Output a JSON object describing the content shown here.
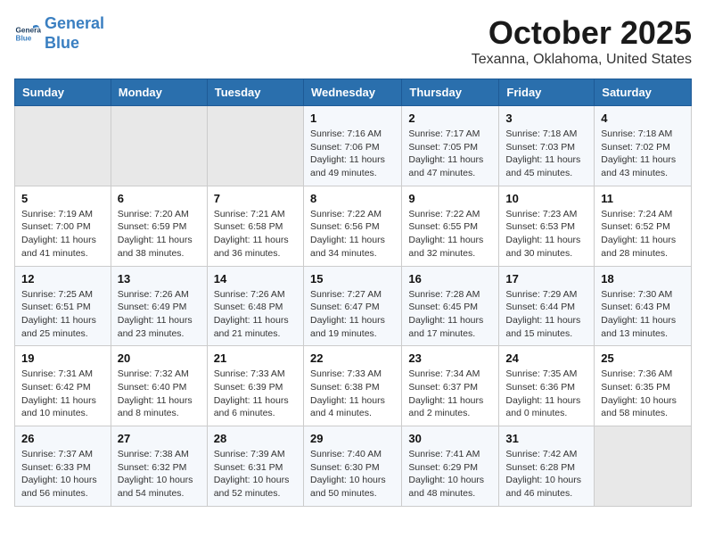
{
  "header": {
    "logo_line1": "General",
    "logo_line2": "Blue",
    "month": "October 2025",
    "location": "Texanna, Oklahoma, United States"
  },
  "weekdays": [
    "Sunday",
    "Monday",
    "Tuesday",
    "Wednesday",
    "Thursday",
    "Friday",
    "Saturday"
  ],
  "weeks": [
    [
      {
        "day": "",
        "info": ""
      },
      {
        "day": "",
        "info": ""
      },
      {
        "day": "",
        "info": ""
      },
      {
        "day": "1",
        "info": "Sunrise: 7:16 AM\nSunset: 7:06 PM\nDaylight: 11 hours and 49 minutes."
      },
      {
        "day": "2",
        "info": "Sunrise: 7:17 AM\nSunset: 7:05 PM\nDaylight: 11 hours and 47 minutes."
      },
      {
        "day": "3",
        "info": "Sunrise: 7:18 AM\nSunset: 7:03 PM\nDaylight: 11 hours and 45 minutes."
      },
      {
        "day": "4",
        "info": "Sunrise: 7:18 AM\nSunset: 7:02 PM\nDaylight: 11 hours and 43 minutes."
      }
    ],
    [
      {
        "day": "5",
        "info": "Sunrise: 7:19 AM\nSunset: 7:00 PM\nDaylight: 11 hours and 41 minutes."
      },
      {
        "day": "6",
        "info": "Sunrise: 7:20 AM\nSunset: 6:59 PM\nDaylight: 11 hours and 38 minutes."
      },
      {
        "day": "7",
        "info": "Sunrise: 7:21 AM\nSunset: 6:58 PM\nDaylight: 11 hours and 36 minutes."
      },
      {
        "day": "8",
        "info": "Sunrise: 7:22 AM\nSunset: 6:56 PM\nDaylight: 11 hours and 34 minutes."
      },
      {
        "day": "9",
        "info": "Sunrise: 7:22 AM\nSunset: 6:55 PM\nDaylight: 11 hours and 32 minutes."
      },
      {
        "day": "10",
        "info": "Sunrise: 7:23 AM\nSunset: 6:53 PM\nDaylight: 11 hours and 30 minutes."
      },
      {
        "day": "11",
        "info": "Sunrise: 7:24 AM\nSunset: 6:52 PM\nDaylight: 11 hours and 28 minutes."
      }
    ],
    [
      {
        "day": "12",
        "info": "Sunrise: 7:25 AM\nSunset: 6:51 PM\nDaylight: 11 hours and 25 minutes."
      },
      {
        "day": "13",
        "info": "Sunrise: 7:26 AM\nSunset: 6:49 PM\nDaylight: 11 hours and 23 minutes."
      },
      {
        "day": "14",
        "info": "Sunrise: 7:26 AM\nSunset: 6:48 PM\nDaylight: 11 hours and 21 minutes."
      },
      {
        "day": "15",
        "info": "Sunrise: 7:27 AM\nSunset: 6:47 PM\nDaylight: 11 hours and 19 minutes."
      },
      {
        "day": "16",
        "info": "Sunrise: 7:28 AM\nSunset: 6:45 PM\nDaylight: 11 hours and 17 minutes."
      },
      {
        "day": "17",
        "info": "Sunrise: 7:29 AM\nSunset: 6:44 PM\nDaylight: 11 hours and 15 minutes."
      },
      {
        "day": "18",
        "info": "Sunrise: 7:30 AM\nSunset: 6:43 PM\nDaylight: 11 hours and 13 minutes."
      }
    ],
    [
      {
        "day": "19",
        "info": "Sunrise: 7:31 AM\nSunset: 6:42 PM\nDaylight: 11 hours and 10 minutes."
      },
      {
        "day": "20",
        "info": "Sunrise: 7:32 AM\nSunset: 6:40 PM\nDaylight: 11 hours and 8 minutes."
      },
      {
        "day": "21",
        "info": "Sunrise: 7:33 AM\nSunset: 6:39 PM\nDaylight: 11 hours and 6 minutes."
      },
      {
        "day": "22",
        "info": "Sunrise: 7:33 AM\nSunset: 6:38 PM\nDaylight: 11 hours and 4 minutes."
      },
      {
        "day": "23",
        "info": "Sunrise: 7:34 AM\nSunset: 6:37 PM\nDaylight: 11 hours and 2 minutes."
      },
      {
        "day": "24",
        "info": "Sunrise: 7:35 AM\nSunset: 6:36 PM\nDaylight: 11 hours and 0 minutes."
      },
      {
        "day": "25",
        "info": "Sunrise: 7:36 AM\nSunset: 6:35 PM\nDaylight: 10 hours and 58 minutes."
      }
    ],
    [
      {
        "day": "26",
        "info": "Sunrise: 7:37 AM\nSunset: 6:33 PM\nDaylight: 10 hours and 56 minutes."
      },
      {
        "day": "27",
        "info": "Sunrise: 7:38 AM\nSunset: 6:32 PM\nDaylight: 10 hours and 54 minutes."
      },
      {
        "day": "28",
        "info": "Sunrise: 7:39 AM\nSunset: 6:31 PM\nDaylight: 10 hours and 52 minutes."
      },
      {
        "day": "29",
        "info": "Sunrise: 7:40 AM\nSunset: 6:30 PM\nDaylight: 10 hours and 50 minutes."
      },
      {
        "day": "30",
        "info": "Sunrise: 7:41 AM\nSunset: 6:29 PM\nDaylight: 10 hours and 48 minutes."
      },
      {
        "day": "31",
        "info": "Sunrise: 7:42 AM\nSunset: 6:28 PM\nDaylight: 10 hours and 46 minutes."
      },
      {
        "day": "",
        "info": ""
      }
    ]
  ]
}
